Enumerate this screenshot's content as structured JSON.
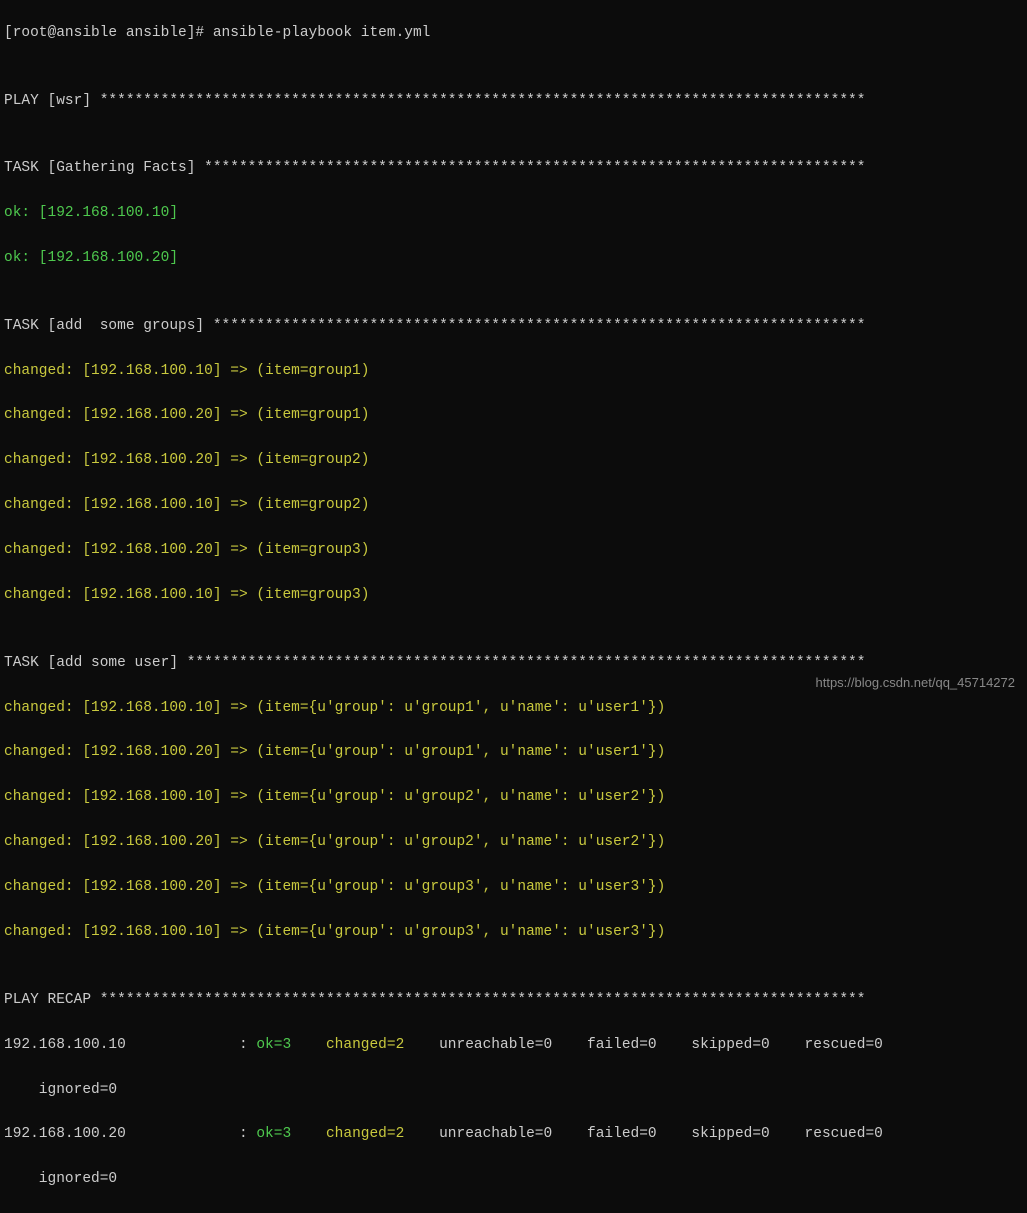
{
  "prompt_line": "[root@ansible ansible]# ansible-playbook item.yml",
  "blank": "",
  "play_header": "PLAY [wsr] ****************************************************************************************",
  "task_gathering": "TASK [Gathering Facts] ****************************************************************************",
  "gather_ok1": "ok: [192.168.100.10]",
  "gather_ok2": "ok: [192.168.100.20]",
  "task_groups": "TASK [add  some groups] ***************************************************************************",
  "group_lines": [
    "changed: [192.168.100.10] => (item=group1)",
    "changed: [192.168.100.20] => (item=group1)",
    "changed: [192.168.100.20] => (item=group2)",
    "changed: [192.168.100.10] => (item=group2)",
    "changed: [192.168.100.20] => (item=group3)",
    "changed: [192.168.100.10] => (item=group3)"
  ],
  "task_users": "TASK [add some user] ******************************************************************************",
  "user_lines": [
    "changed: [192.168.100.10] => (item={u'group': u'group1', u'name': u'user1'})",
    "changed: [192.168.100.20] => (item={u'group': u'group1', u'name': u'user1'})",
    "changed: [192.168.100.10] => (item={u'group': u'group2', u'name': u'user2'})",
    "changed: [192.168.100.20] => (item={u'group': u'group2', u'name': u'user2'})",
    "changed: [192.168.100.20] => (item={u'group': u'group3', u'name': u'user3'})",
    "changed: [192.168.100.10] => (item={u'group': u'group3', u'name': u'user3'})"
  ],
  "play_recap": "PLAY RECAP ****************************************************************************************",
  "recap1_host": "192.168.100.10             : ",
  "recap1_ok": "ok=3   ",
  "recap1_changed": " changed=2   ",
  "recap1_rest": " unreachable=0    failed=0    skipped=0    rescued=0",
  "recap1_ignored": "    ignored=0",
  "recap2_host": "192.168.100.20             : ",
  "recap2_ok": "ok=3   ",
  "recap2_changed": " changed=2   ",
  "recap2_rest": " unreachable=0    failed=0    skipped=0    rescued=0",
  "recap2_ignored": "    ignored=0",
  "watermark": "https://blog.csdn.net/qq_45714272"
}
